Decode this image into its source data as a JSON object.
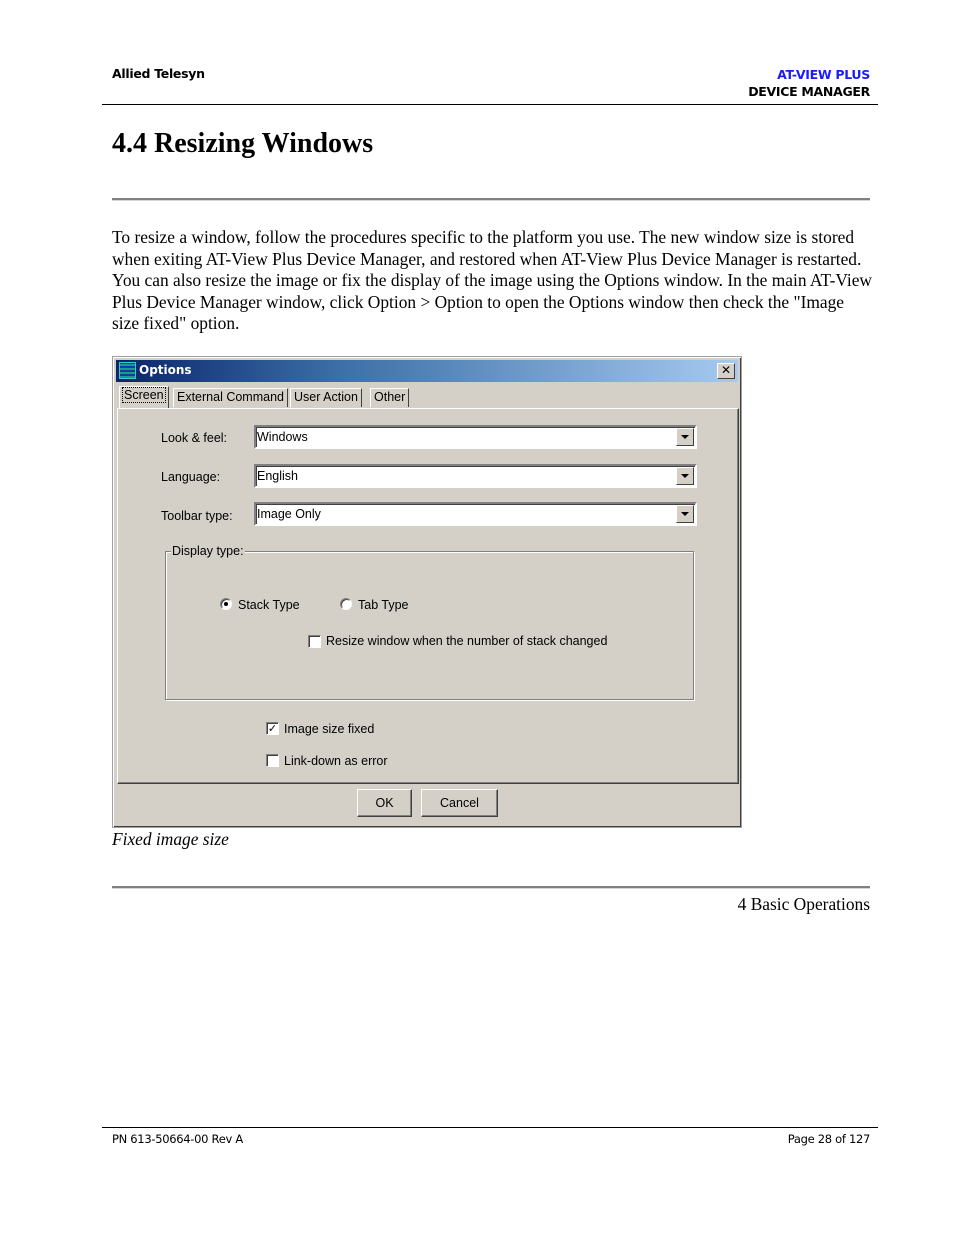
{
  "header": {
    "company": "Allied Telesyn",
    "product_line1": "AT-VIEW PLUS",
    "product_line2": "DEVICE MANAGER",
    "accent_color": "#1a1aff"
  },
  "section": {
    "title": "4.4 Resizing Windows",
    "paragraph": "To resize a window, follow the procedures specific to the platform you use. The new window size is stored when exiting AT-View Plus Device Manager, and restored when AT-View Plus Device Manager is restarted. You can also resize the image or fix the display of the image using the Options window. In the main AT-View Plus Device Manager window, click Option > Option to open the Options window then check the \"Image size fixed\" option."
  },
  "dialog": {
    "title": "Options",
    "app_icon": "grid-app-icon",
    "close_icon": "close-icon",
    "close_glyph": "✕",
    "tabs": [
      {
        "label": "Screen",
        "active": true
      },
      {
        "label": "External Command",
        "active": false
      },
      {
        "label": "User Action",
        "active": false
      },
      {
        "label": "Other",
        "active": false
      }
    ],
    "fields": {
      "look_feel": {
        "label": "Look & feel:",
        "value": "Windows"
      },
      "language": {
        "label": "Language:",
        "value": "English"
      },
      "toolbar_type": {
        "label": "Toolbar type:",
        "value": "Image Only"
      }
    },
    "display_type": {
      "legend": "Display type:",
      "options": [
        {
          "label": "Stack Type",
          "selected": true
        },
        {
          "label": "Tab Type",
          "selected": false
        }
      ],
      "resize_checkbox": {
        "label": "Resize window when the number of stack changed",
        "checked": false
      }
    },
    "image_size_fixed": {
      "label": "Image size fixed",
      "checked": true,
      "glyph": "✓"
    },
    "link_down_error": {
      "label": "Link-down as error",
      "checked": false
    },
    "buttons": {
      "ok": "OK",
      "cancel": "Cancel"
    }
  },
  "figure_caption": "Fixed image size",
  "chapter_footer": "4 Basic Operations",
  "footer": {
    "part_number": "PN 613-50664-00 Rev A",
    "page": "Page 28 of 127"
  }
}
